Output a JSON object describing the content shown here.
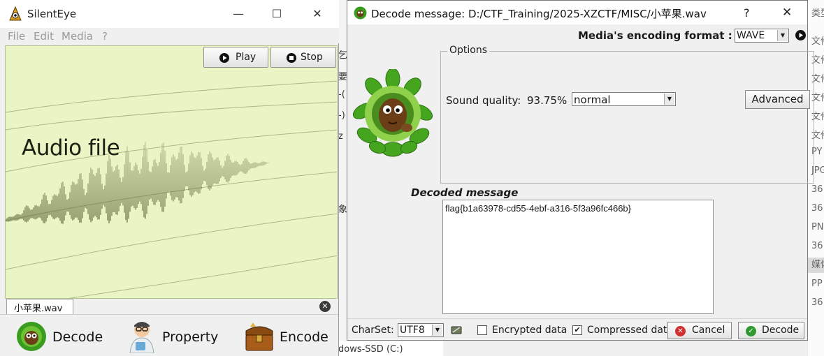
{
  "left_window": {
    "title": "SilentEye",
    "controls": {
      "minimize": "—",
      "maximize": "☐",
      "close": "✕"
    },
    "menu": [
      "File",
      "Edit",
      "Media",
      "?"
    ],
    "media": {
      "overlay_text": "Audio file",
      "play_label": "Play",
      "stop_label": "Stop"
    },
    "file_tab": "小苹果.wav",
    "close_tab": "✕",
    "actions": [
      {
        "label": "Decode",
        "icon": "bush-face-icon"
      },
      {
        "label": "Property",
        "icon": "scientist-icon"
      },
      {
        "label": "Encode",
        "icon": "treasure-chest-icon"
      }
    ]
  },
  "decode_dialog": {
    "title": "Decode message: D:/CTF_Training/2025-XZCTF/MISC/小苹果.wav",
    "help": "?",
    "close": "✕",
    "format_label": "Media's encoding format :",
    "format_value": "WAVE",
    "options": {
      "title": "Options",
      "quality_label": "Sound quality:",
      "quality_pct": "93.75%",
      "quality_value": "normal",
      "advanced_label": "Advanced"
    },
    "decoded_label": "Decoded message",
    "decoded_text": "flag{b1a63978-cd55-4ebf-a316-5f3a96fc466b}",
    "footer": {
      "charset_label": "CharSet:",
      "charset_value": "UTF8",
      "encrypted_label": "Encrypted data",
      "encrypted_checked": false,
      "compressed_label": "Compressed dat",
      "compressed_checked": true,
      "cancel_label": "Cancel",
      "decode_label": "Decode"
    }
  },
  "background_explorer": {
    "right_items": [
      "类型",
      "文件",
      "文件",
      "文件",
      "文件",
      "文件",
      "文件",
      "PY",
      "JPG",
      "36",
      "36",
      "PN",
      "36",
      "媒体",
      "PP",
      "36"
    ],
    "middle_fragments": [
      "乞",
      "要",
      "-(",
      "-)",
      "z",
      "",
      "象",
      "",
      ""
    ],
    "bottom_text": "dows-SSD (C:)"
  },
  "colors": {
    "media_bg": "#e9f5c4",
    "waveform": "#5f6b3a",
    "cancel_icon": "#d23030",
    "decode_icon": "#2f9a2f"
  }
}
